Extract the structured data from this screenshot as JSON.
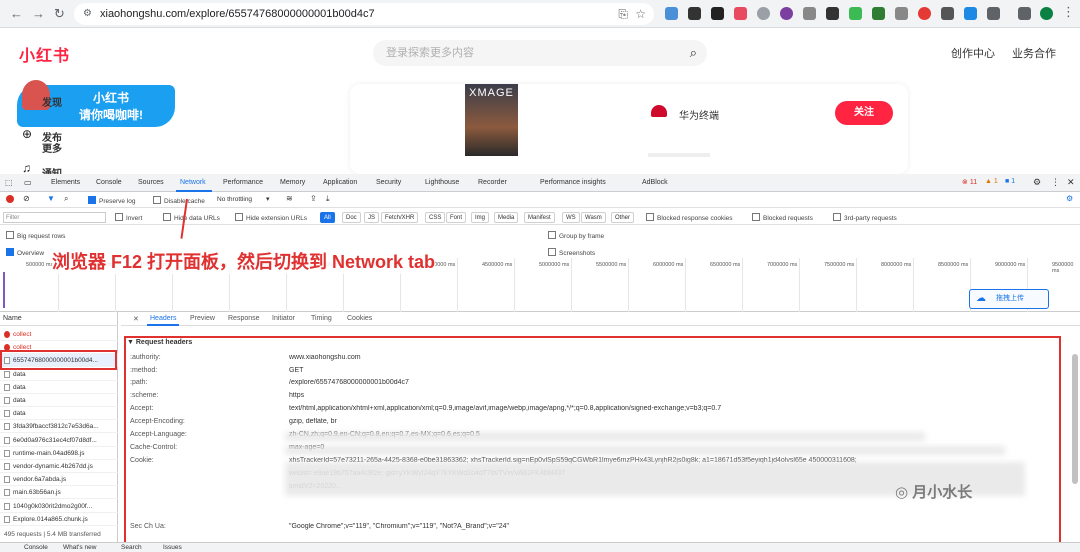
{
  "browser": {
    "url": "xiaohongshu.com/explore/65574768000000001b00d4c7"
  },
  "site": {
    "logo": "小红书",
    "search_placeholder": "登录探索更多内容",
    "links": [
      "创作中心",
      "业务合作"
    ],
    "nav": [
      "发现",
      "发布",
      "更多",
      "通知"
    ],
    "promo_line1": "小红书",
    "promo_line2": "请你喝咖啡!",
    "thumb_text": "XMAGE",
    "author": "华为终端",
    "follow": "关注"
  },
  "devtools": {
    "tabs": [
      "Elements",
      "Console",
      "Sources",
      "Network",
      "Performance",
      "Memory",
      "Application",
      "Security",
      "Lighthouse",
      "Recorder",
      "Performance insights",
      "AdBlock"
    ],
    "active_tab": "Network",
    "badges": {
      "errors": "11",
      "warnings": "1",
      "info": "1"
    },
    "toolbar": {
      "preserve_log": "Preserve log",
      "disable_cache": "Disable cache",
      "throttling": "No throttling"
    },
    "filter": {
      "placeholder": "Filter",
      "invert": "Invert",
      "hide_data": "Hide data URLs",
      "hide_ext": "Hide extension URLs",
      "types": [
        "All",
        "Doc",
        "JS",
        "Fetch/XHR",
        "CSS",
        "Font",
        "Img",
        "Media",
        "Manifest",
        "WS",
        "Wasm",
        "Other"
      ],
      "blocked_cookies": "Blocked response cookies",
      "blocked_requests": "Blocked requests",
      "third_party": "3rd-party requests"
    },
    "options": {
      "big_rows": "Big request rows",
      "overview": "Overview",
      "group_frame": "Group by frame",
      "screenshots": "Screenshots"
    },
    "timeline_ticks": [
      "500000 ms",
      "1000000 ms",
      "1500000 ms",
      "2000000 ms",
      "2500000 ms",
      "3000000 ms",
      "3500000 ms",
      "4000000 ms",
      "4500000 ms",
      "5000000 ms",
      "5500000 ms",
      "6000000 ms",
      "6500000 ms",
      "7000000 ms",
      "7500000 ms",
      "8000000 ms",
      "8500000 ms",
      "9000000 ms",
      "9500000 ms"
    ],
    "annotation": "浏览器 F12 打开面板，然后切换到 Network tab",
    "upload_button": "拖拽上传",
    "name_header": "Name",
    "requests": [
      {
        "name": "collect",
        "error": true
      },
      {
        "name": "collect",
        "error": true
      },
      {
        "name": "65574768000000001b00d4...",
        "error": false
      },
      {
        "name": "data",
        "error": false
      },
      {
        "name": "data",
        "error": false
      },
      {
        "name": "data",
        "error": false
      },
      {
        "name": "data",
        "error": false
      },
      {
        "name": "3fda39fbaccf3812c7e53d6a...",
        "error": false
      },
      {
        "name": "6e0d0a976c31ec4cf07d8df...",
        "error": false
      },
      {
        "name": "runtime-main.04ad698.js",
        "error": false
      },
      {
        "name": "vendor-dynamic.4b267dd.js",
        "error": false
      },
      {
        "name": "vendor.6a7abda.js",
        "error": false
      },
      {
        "name": "main.63b56an.js",
        "error": false
      },
      {
        "name": "1040g0k030rit2dmo2g00f...",
        "error": false
      },
      {
        "name": "Explore.014a865.chunk.js",
        "error": false
      }
    ],
    "footer_count": "495 requests | 5.4 MB transferred",
    "detail_tabs": [
      "Headers",
      "Preview",
      "Response",
      "Initiator",
      "Timing",
      "Cookies"
    ],
    "section_title": "▼ Request headers",
    "headers": [
      {
        "k": ":authority:",
        "v": "www.xiaohongshu.com"
      },
      {
        "k": ":method:",
        "v": "GET"
      },
      {
        "k": ":path:",
        "v": "/explore/65574768000000001b00d4c7"
      },
      {
        "k": ":scheme:",
        "v": "https"
      },
      {
        "k": "Accept:",
        "v": "text/html,application/xhtml+xml,application/xml;q=0.9,image/avif,image/webp,image/apng,*/*;q=0.8,application/signed-exchange;v=b3;q=0.7"
      },
      {
        "k": "Accept-Encoding:",
        "v": "gzip, deflate, br"
      },
      {
        "k": "Accept-Language:",
        "v": "zh-CN,zh;q=0.9,en-CN;q=0.8,en;q=0.7,es-MX;q=0.6,es;q=0.5"
      },
      {
        "k": "Cache-Control:",
        "v": "max-age=0"
      },
      {
        "k": "Cookie:",
        "v": "xhsTrackerId=57e73211-265a-4425-8368-e0be31863362; xhsTrackerId.sig=nEp0vlSpS59qCGWbR1lmye6mzPHx43LynjhR2js0ig8k; a1=18671d53f5eyiqh1jd4olvsl65e  450000311608;"
      },
      {
        "k": "",
        "v": "webId=              e9ae19b757aa4c9f2e; gid=yYKWyf24qY7kYKWd2o4dT7dvTVxvVA81FK4bM437"
      },
      {
        "k": "",
        "v": "smidV2=20220..."
      },
      {
        "k": "Sec Ch Ua:",
        "v": "\"Google Chrome\";v=\"119\", \"Chromium\";v=\"119\", \"Not?A_Brand\";v=\"24\""
      }
    ],
    "bottom_tabs": [
      "Console",
      "What's new",
      "Search",
      "Issues"
    ]
  },
  "watermark": "月小水长",
  "colors": {
    "brand": "#ff2442",
    "accent": "#1a73e8",
    "annotation": "#e03131"
  }
}
